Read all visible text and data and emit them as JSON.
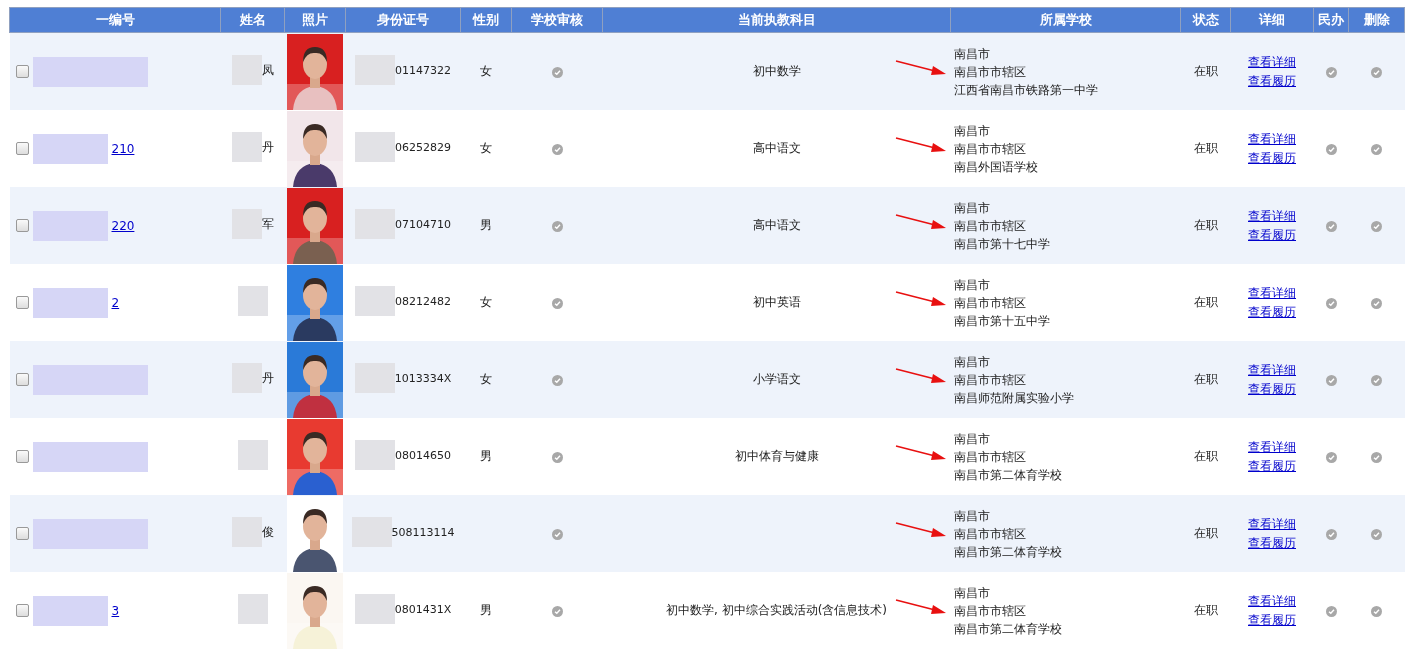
{
  "table": {
    "columns": [
      "一编号",
      "姓名",
      "照片",
      "身份证号",
      "性别",
      "学校审核",
      "当前执教科目",
      "所属学校",
      "状态",
      "详细",
      "民办",
      "删除"
    ],
    "rows": [
      {
        "checked": false,
        "code": "",
        "name": "凤",
        "photo": {
          "kind": "picture"
        },
        "id_number": "01147322",
        "gender": "女",
        "subject": "初中数学",
        "school": [
          "南昌市",
          "南昌市市辖区",
          "江西省南昌市铁路第一中学"
        ],
        "status": "在职",
        "links": [
          "查看详细",
          "查看履历"
        ]
      },
      {
        "checked": false,
        "code": "210",
        "name": "丹",
        "photo": {
          "kind": "picture"
        },
        "id_number": "06252829",
        "gender": "女",
        "subject": "高中语文",
        "school": [
          "南昌市",
          "南昌市市辖区",
          "南昌外国语学校"
        ],
        "status": "在职",
        "links": [
          "查看详细",
          "查看履历"
        ]
      },
      {
        "checked": false,
        "code": "220",
        "name": "军",
        "photo": {
          "kind": "picture"
        },
        "id_number": "07104710",
        "gender": "男",
        "subject": "高中语文",
        "school": [
          "南昌市",
          "南昌市市辖区",
          "南昌市第十七中学"
        ],
        "status": "在职",
        "links": [
          "查看详细",
          "查看履历"
        ]
      },
      {
        "checked": false,
        "code": "2",
        "name": "",
        "photo": {
          "kind": "picture"
        },
        "id_number": "08212482",
        "gender": "女",
        "subject": "初中英语",
        "school": [
          "南昌市",
          "南昌市市辖区",
          "南昌市第十五中学"
        ],
        "status": "在职",
        "links": [
          "查看详细",
          "查看履历"
        ]
      },
      {
        "checked": false,
        "code": "",
        "name": "丹",
        "photo": {
          "kind": "picture"
        },
        "id_number": "1013334X",
        "gender": "女",
        "subject": "小学语文",
        "school": [
          "南昌市",
          "南昌市市辖区",
          "南昌师范附属实验小学"
        ],
        "status": "在职",
        "links": [
          "查看详细",
          "查看履历"
        ]
      },
      {
        "checked": false,
        "code": "",
        "name": "",
        "photo": {
          "kind": "picture"
        },
        "id_number": "08014650",
        "gender": "男",
        "subject": "初中体育与健康",
        "school": [
          "南昌市",
          "南昌市市辖区",
          "南昌市第二体育学校"
        ],
        "status": "在职",
        "links": [
          "查看详细",
          "查看履历"
        ]
      },
      {
        "checked": false,
        "code": "",
        "name": "俊",
        "photo": {
          "kind": "picture"
        },
        "id_number": "508113114",
        "gender": "",
        "subject": "",
        "school": [
          "南昌市",
          "南昌市市辖区",
          "南昌市第二体育学校"
        ],
        "status": "在职",
        "links": [
          "查看详细",
          "查看履历"
        ]
      },
      {
        "checked": false,
        "code": "3",
        "name": "",
        "photo": {
          "kind": "picture"
        },
        "id_number": "0801431X",
        "gender": "男",
        "subject": "初中数学, 初中综合实践活动(含信息技术)",
        "school": [
          "南昌市",
          "南昌市市辖区",
          "南昌市第二体育学校"
        ],
        "status": "在职",
        "links": [
          "查看详细",
          "查看履历"
        ]
      }
    ]
  }
}
